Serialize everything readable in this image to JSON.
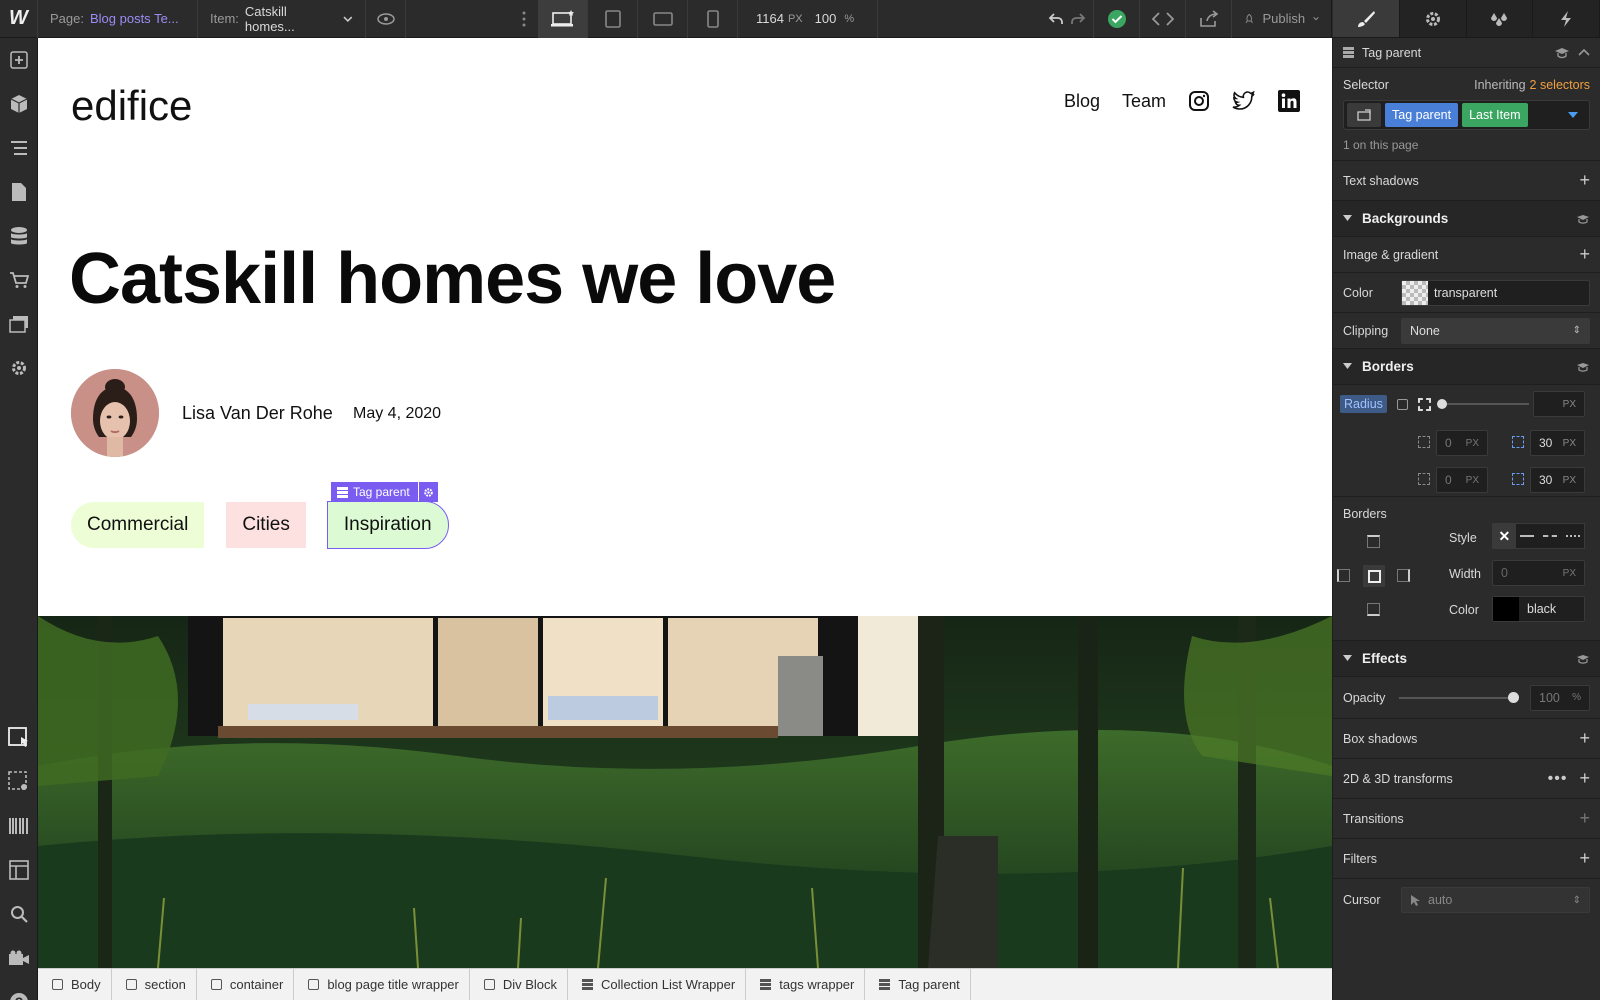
{
  "topbar": {
    "page_label": "Page:",
    "page_value": "Blog posts Te...",
    "item_label": "Item:",
    "item_value": "Catskill homes...",
    "width_value": "1164",
    "width_unit": "PX",
    "zoom_value": "100",
    "zoom_unit": "%",
    "publish_label": "Publish"
  },
  "site": {
    "logo": "edifice",
    "nav": [
      "Blog",
      "Team"
    ],
    "title": "Catskill homes we love",
    "author": "Lisa Van Der Rohe",
    "date": "May 4, 2020",
    "tags": [
      "Commercial",
      "Cities",
      "Inspiration"
    ],
    "selected_badge": "Tag parent"
  },
  "panel": {
    "element_label": "Tag parent",
    "selector_label": "Selector",
    "inheriting_label": "Inheriting",
    "inheriting_link": "2 selectors",
    "chip1": "Tag parent",
    "chip2": "Last Item",
    "on_page": "1 on this page",
    "text_shadows": "Text shadows",
    "backgrounds": "Backgrounds",
    "image_gradient": "Image & gradient",
    "color_label": "Color",
    "color_value": "transparent",
    "clipping_label": "Clipping",
    "clipping_value": "None",
    "borders_head": "Borders",
    "radius_label": "Radius",
    "radius_tl": "0",
    "radius_tr": "30",
    "radius_bl": "0",
    "radius_br": "30",
    "px": "PX",
    "borders_label": "Borders",
    "style_label": "Style",
    "width_label": "Width",
    "width_value": "0",
    "bcolor_label": "Color",
    "bcolor_value": "black",
    "effects": "Effects",
    "opacity_label": "Opacity",
    "opacity_value": "100",
    "opacity_unit": "%",
    "box_shadows": "Box shadows",
    "transforms": "2D & 3D transforms",
    "transitions": "Transitions",
    "filters": "Filters",
    "cursor_label": "Cursor",
    "cursor_value": "auto"
  },
  "breadcrumb": [
    "Body",
    "section",
    "container",
    "blog page title wrapper",
    "Div Block",
    "Collection List Wrapper",
    "tags wrapper",
    "Tag parent"
  ],
  "colors": {
    "accent": "#4a7fd8",
    "green": "#3aa661",
    "purple": "#7a5cf0",
    "orange": "#f0a040",
    "tag1": "#edfdd6",
    "tag2": "#fde1e1",
    "tag3": "#dcfbd4"
  }
}
